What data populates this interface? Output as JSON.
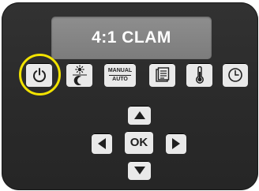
{
  "display": {
    "text": "4:1 CLAM"
  },
  "buttons": {
    "mode_top_label": "MANUAL",
    "mode_bottom_label": "AUTO",
    "ok_label": "OK"
  },
  "colors": {
    "panel": "#2e2e2e",
    "lcd": "#878787",
    "button_face": "#e9e9e9",
    "highlight": "#f2e300"
  },
  "icons": {
    "power": "power-icon",
    "day_night": "sun-moon-icon",
    "mode": "manual-auto-icon",
    "menu": "document-list-icon",
    "temperature": "thermometer-icon",
    "clock": "clock-icon",
    "up": "arrow-up-icon",
    "down": "arrow-down-icon",
    "left": "arrow-left-icon",
    "right": "arrow-right-icon"
  },
  "highlighted_button": "power"
}
